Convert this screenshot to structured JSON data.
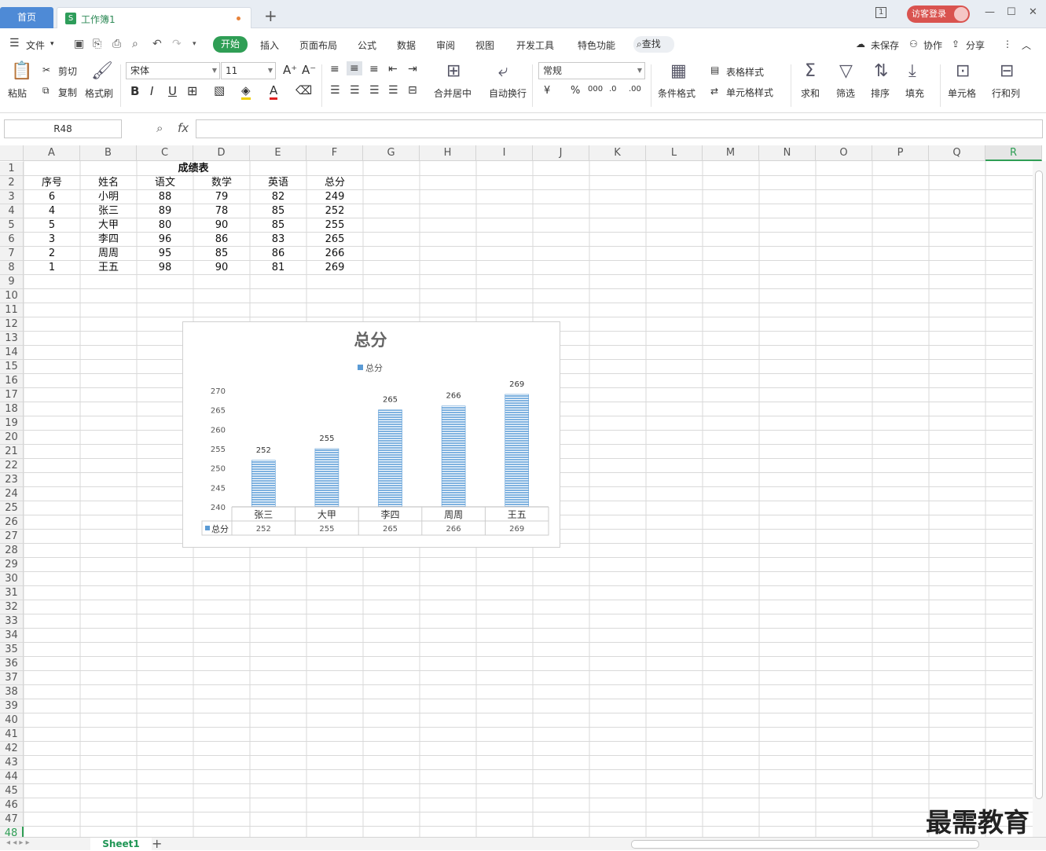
{
  "tabs": {
    "home": "首页",
    "workbook": "工作簿1",
    "workbook_icon": "S",
    "new": "+"
  },
  "titlebar": {
    "login": "访客登录",
    "page_badge": "1"
  },
  "menu": {
    "file": "文件",
    "items": [
      "插入",
      "页面布局",
      "公式",
      "数据",
      "审阅",
      "视图",
      "开发工具",
      "特色功能"
    ],
    "start": "开始",
    "search": "查找",
    "unsaved": "未保存",
    "collab": "协作",
    "share": "分享"
  },
  "ribbon": {
    "paste": "粘贴",
    "cut": "剪切",
    "copy": "复制",
    "format_painter": "格式刷",
    "font_name": "宋体",
    "font_size": "11",
    "merge": "合并居中",
    "wrap": "自动换行",
    "number_format": "常规",
    "cond_format": "条件格式",
    "table_style": "表格样式",
    "cell_style": "单元格样式",
    "sum": "求和",
    "filter": "筛选",
    "sort": "排序",
    "fill": "填充",
    "cell": "单元格",
    "rowcol": "行和列"
  },
  "formula_bar": {
    "name_box": "R48",
    "fx": "fx",
    "value": ""
  },
  "columns": [
    "A",
    "B",
    "C",
    "D",
    "E",
    "F",
    "G",
    "H",
    "I",
    "J",
    "K",
    "L",
    "M",
    "N",
    "O",
    "P",
    "Q",
    "R"
  ],
  "selected_column": "R",
  "rows": 48,
  "sheet": {
    "title": "成绩表",
    "headers": [
      "序号",
      "姓名",
      "语文",
      "数学",
      "英语",
      "总分"
    ],
    "data": [
      [
        "6",
        "小明",
        "88",
        "79",
        "82",
        "249"
      ],
      [
        "4",
        "张三",
        "89",
        "78",
        "85",
        "252"
      ],
      [
        "5",
        "大甲",
        "80",
        "90",
        "85",
        "255"
      ],
      [
        "3",
        "李四",
        "96",
        "86",
        "83",
        "265"
      ],
      [
        "2",
        "周周",
        "95",
        "85",
        "86",
        "266"
      ],
      [
        "1",
        "王五",
        "98",
        "90",
        "81",
        "269"
      ]
    ]
  },
  "chart_data": {
    "type": "bar",
    "title": "总分",
    "categories": [
      "张三",
      "大甲",
      "李四",
      "周周",
      "王五"
    ],
    "series": [
      {
        "name": "总分",
        "values": [
          252,
          255,
          265,
          266,
          269
        ],
        "color": "#5b9bd5"
      }
    ],
    "ylim": [
      240,
      270
    ],
    "yticks": [
      240,
      245,
      250,
      255,
      260,
      265,
      270
    ],
    "legend": "top",
    "data_table": true
  },
  "sheet_tab": "Sheet1",
  "watermark": "最需教育",
  "colors": {
    "accent_green": "#2f9e55",
    "home_tab": "#4e8ad6",
    "login": "#d9534f",
    "bar": "#5b9bd5"
  }
}
